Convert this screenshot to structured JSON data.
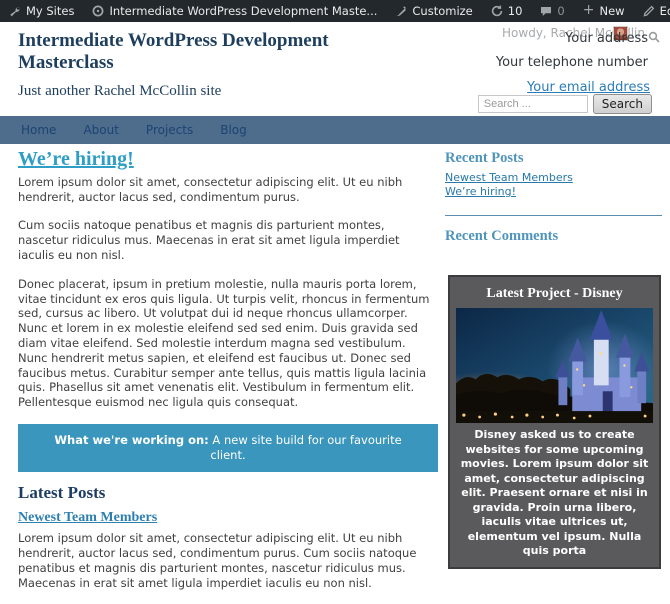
{
  "admin_bar": {
    "my_sites": "My Sites",
    "site_name": "Intermediate WordPress Development Maste...",
    "customize": "Customize",
    "updates_count": "10",
    "comments_count": "0",
    "new_label": "New",
    "edit_post": "Edit Post",
    "howdy": "Howdy, Rachel McCollin"
  },
  "header": {
    "site_title": "Intermediate WordPress Development Masterclass",
    "tagline": "Just another Rachel McCollin site",
    "address": "Your address",
    "phone": "Your telephone number",
    "email": "Your email address",
    "search_placeholder": "Search ...",
    "search_button": "Search"
  },
  "nav": {
    "items": [
      "Home",
      "About",
      "Projects",
      "Blog"
    ]
  },
  "main": {
    "post_title": "We’re hiring!",
    "paragraphs": [
      "Lorem ipsum dolor sit amet, consectetur adipiscing elit. Ut eu nibh hendrerit, auctor lacus sed, condimentum purus.",
      "Cum sociis natoque penatibus et magnis dis parturient montes, nascetur ridiculus mus. Maecenas in erat sit amet ligula imperdiet iaculis eu non nisl.",
      "Donec placerat, ipsum in pretium molestie, nulla mauris porta lorem, vitae tincidunt ex eros quis ligula. Ut turpis velit, rhoncus in fermentum sed, cursus ac libero. Ut volutpat dui id neque rhoncus ullamcorper. Nunc et lorem in ex molestie eleifend sed sed enim. Duis gravida sed diam vitae eleifend. Sed molestie interdum magna sed vestibulum. Nunc hendrerit metus sapien, et eleifend est faucibus ut. Donec sed faucibus metus. Curabitur semper ante tellus, quis mattis ligula lacinia quis. Phasellus sit amet venenatis elit. Vestibulum in fermentum elit. Pellentesque euismod nec ligula quis consequat."
    ],
    "callout": {
      "label": "What we're working on:",
      "text": " A new site build for our favourite client."
    },
    "latest_posts_heading": "Latest Posts",
    "latest_post_title": "Newest Team Members",
    "latest_post_excerpt": "Lorem ipsum dolor sit amet, consectetur adipiscing elit. Ut eu nibh hendrerit, auctor lacus sed, condimentum purus. Cum sociis natoque penatibus et magnis dis parturient montes, nascetur ridiculus mus. Maecenas in erat sit amet ligula imperdiet iaculis eu non nisl."
  },
  "sidebar": {
    "recent_posts_heading": "Recent Posts",
    "recent_posts": [
      "Newest Team Members",
      "We’re hiring!"
    ],
    "recent_comments_heading": "Recent Comments",
    "project_widget": {
      "title": "Latest Project - Disney",
      "image_alt": "disney-castle-at-dusk",
      "text": "Disney asked us to create websites for some upcoming movies. Lorem ipsum dolor sit amet, consectetur adipiscing elit. Praesent ornare et nisi in gravida. Proin urna libero, iaculis vitae ultrices ut, elementum vel ipsum. Nulla quis porta"
    }
  },
  "colors": {
    "admin_bar_bg": "#23282d",
    "nav_bg": "#4e6c8b",
    "callout_bg": "#3a96bd",
    "heading_navy": "#1e3e5e",
    "link_teal": "#2f9ec6",
    "sidebar_heading_blue": "#4f94bb",
    "sidebar_link_blue": "#2878aa",
    "widget_bg": "#5a5a5c"
  }
}
